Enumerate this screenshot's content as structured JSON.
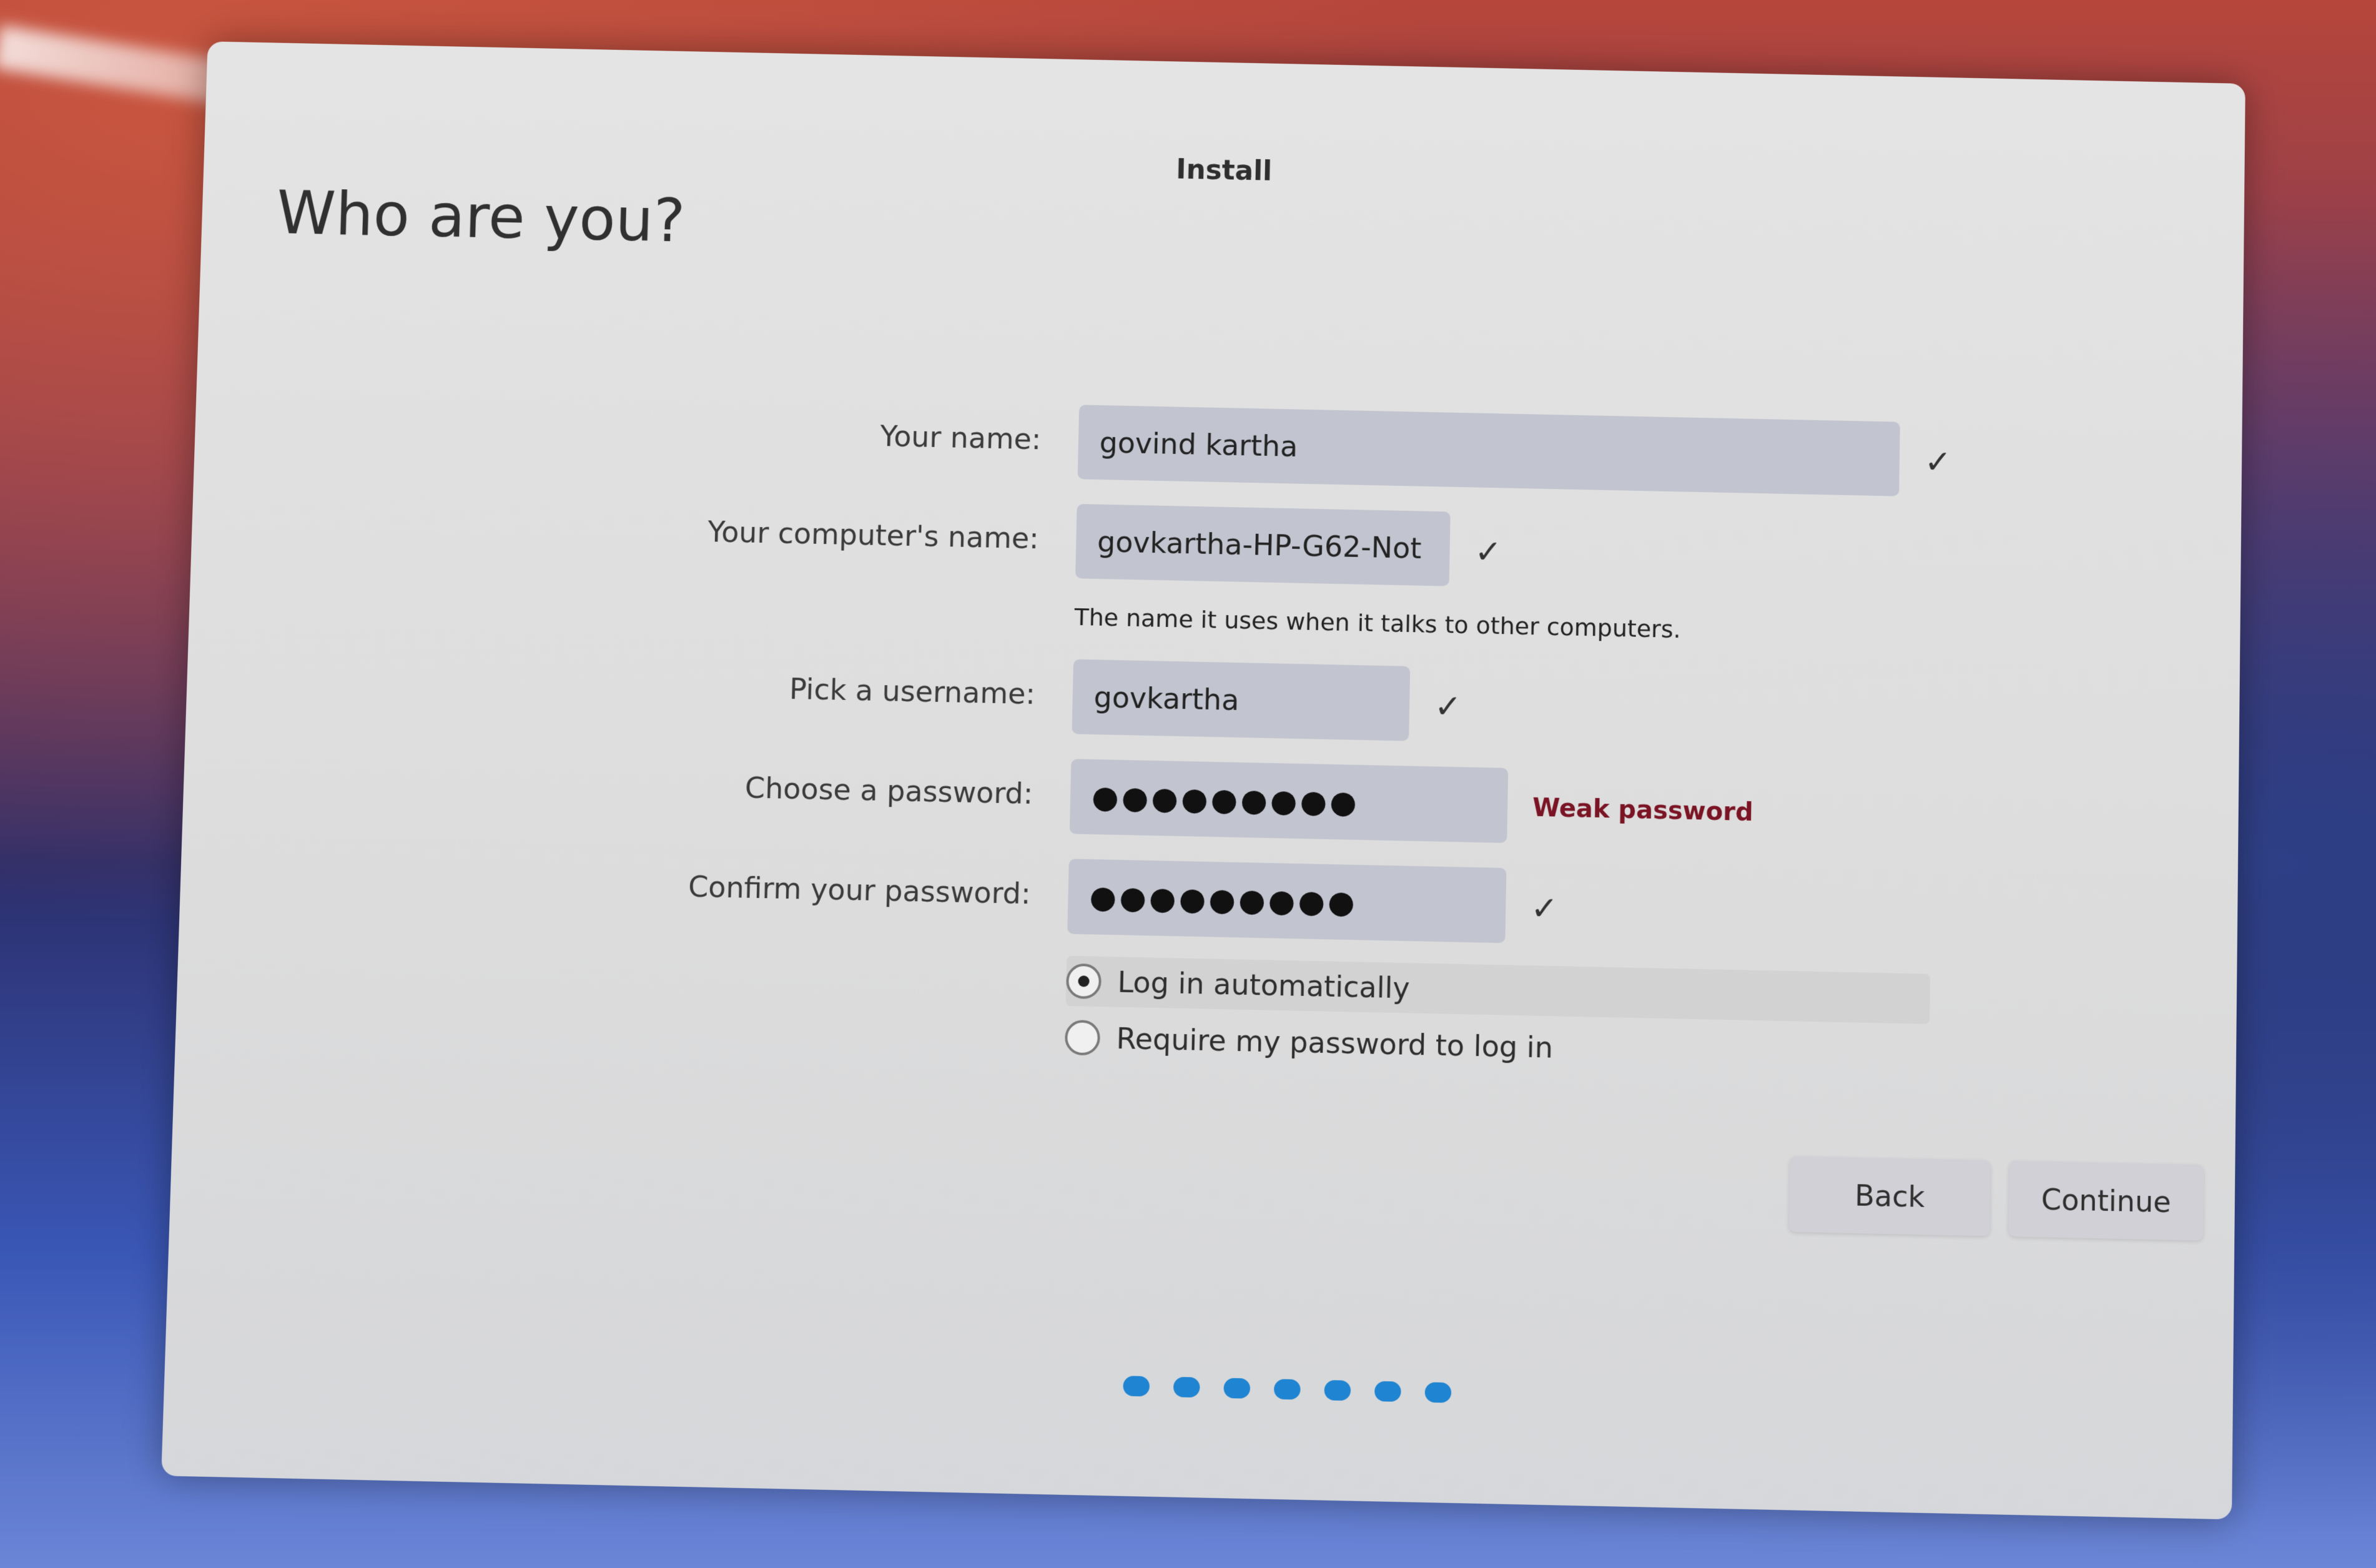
{
  "window": {
    "title": "Install",
    "page_title": "Who are you?"
  },
  "form": {
    "name": {
      "label": "Your name:",
      "value": "govind kartha",
      "check": "✓"
    },
    "computer_name": {
      "label": "Your computer's name:",
      "value": "govkartha-HP-G62-Not",
      "check": "✓",
      "hint": "The name it uses when it talks to other computers."
    },
    "username": {
      "label": "Pick a username:",
      "value": "govkartha",
      "check": "✓"
    },
    "password": {
      "label": "Choose a password:",
      "value": "●●●●●●●●●",
      "strength": "Weak password"
    },
    "confirm_password": {
      "label": "Confirm your password:",
      "value": "●●●●●●●●●",
      "check": "✓"
    }
  },
  "login_options": [
    {
      "label": "Log in automatically",
      "selected": true
    },
    {
      "label": "Require my password to log in",
      "selected": false
    }
  ],
  "buttons": {
    "back": "Back",
    "continue": "Continue"
  },
  "progress": {
    "total_steps": 7,
    "accent_color": "#1f84d1"
  }
}
